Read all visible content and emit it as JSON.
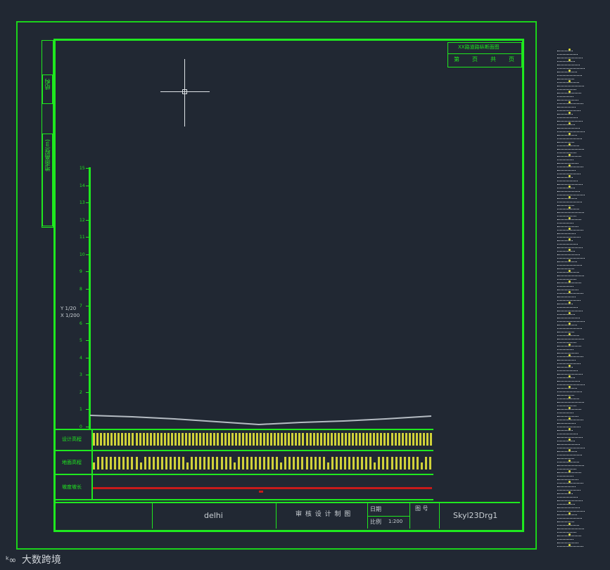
{
  "drawing": {
    "profile_scale": {
      "label_line1": "Y 1/20",
      "label_line2": "X 1/200"
    },
    "left_side_labels": [
      "结构",
      "地面高程(m)"
    ],
    "row_labels": [
      "设计高程",
      "地面高程",
      "坡度坡长"
    ],
    "title_block": {
      "name": "delhi",
      "sign_fields": "审 核 设 计 制 图",
      "date_label": "日期",
      "scale_label": "比例",
      "scale_value": "1:200",
      "sheet_label": "图 号",
      "drawing_no": "Skyl23Drg1"
    },
    "header_box": {
      "title": "XX路道路纵断面图",
      "cells": [
        "第",
        "页",
        "共",
        "页"
      ]
    },
    "y_axis_ticks": [
      "15",
      "14",
      "13",
      "12",
      "11",
      "10",
      "9",
      "8",
      "7",
      "6",
      "5",
      "4",
      "3",
      "2",
      "1",
      "0"
    ]
  },
  "watermark": {
    "text": "大数跨境"
  },
  "colors": {
    "background": "#212833",
    "frame": "#1fe81f",
    "profile_line": "#b5bcc3",
    "data_text": "#e3e33a",
    "slope_line": "#c71a1a"
  }
}
